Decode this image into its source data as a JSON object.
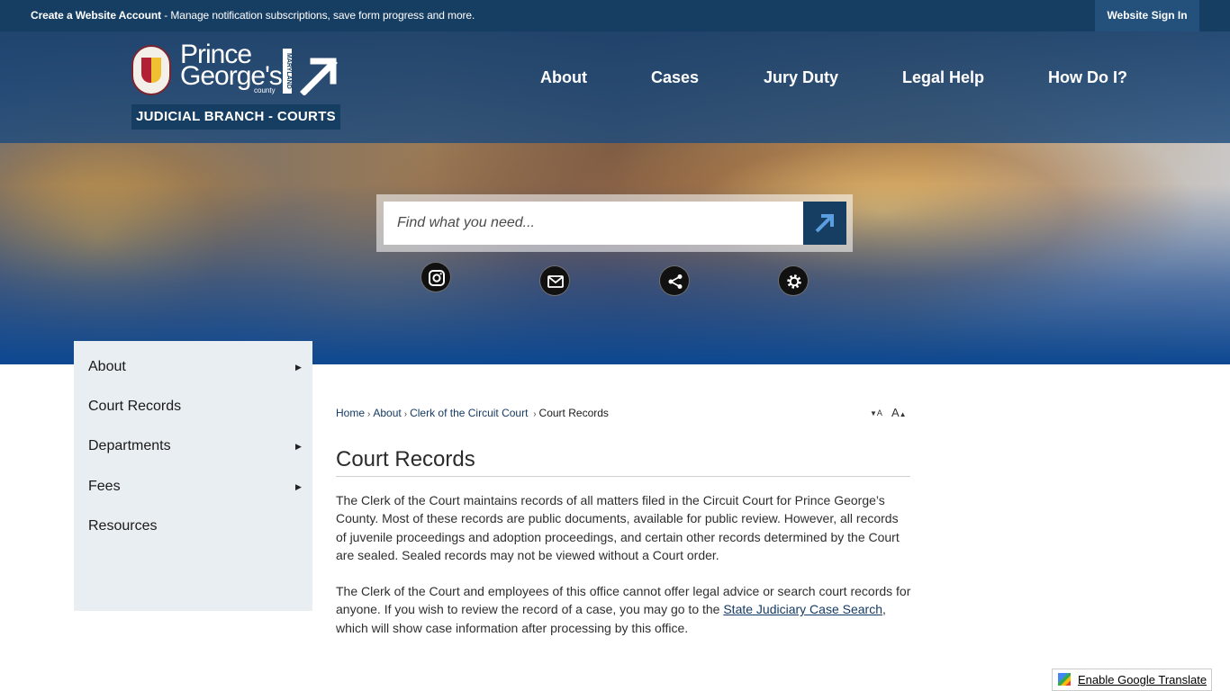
{
  "topbar": {
    "create_account": "Create a Website Account",
    "promo_text": " - Manage notification subscriptions, save form progress and more.",
    "sign_in": "Website Sign In"
  },
  "logo": {
    "line1": "Prince",
    "line2": "George's",
    "county": "county",
    "state": "MARYLAND",
    "subtitle": "JUDICIAL BRANCH - COURTS"
  },
  "nav": {
    "items": [
      "About",
      "Cases",
      "Jury Duty",
      "Legal Help",
      "How Do I?"
    ]
  },
  "search": {
    "placeholder": "Find what you need..."
  },
  "social": {
    "icons": [
      "instagram-icon",
      "email-icon",
      "share-icon",
      "settings-icon"
    ]
  },
  "sidebar": {
    "items": [
      {
        "label": "About",
        "has_submenu": true
      },
      {
        "label": "Court Records",
        "has_submenu": false
      },
      {
        "label": "Departments",
        "has_submenu": true
      },
      {
        "label": "Fees",
        "has_submenu": true
      },
      {
        "label": "Resources",
        "has_submenu": false
      }
    ]
  },
  "breadcrumb": {
    "items": [
      "Home",
      "About",
      "Clerk of the Circuit Court",
      "Court Records"
    ]
  },
  "font_controls": {
    "decrease": "A",
    "increase": "A"
  },
  "content": {
    "title": "Court Records",
    "paragraph1": "The Clerk of the Court maintains records of all matters filed in the Circuit Court for Prince George’s County. Most of these records are public documents, available for public review. However, all records of juvenile proceedings and adoption proceedings, and certain other records determined by the Court are sealed. Sealed records may not be viewed without a Court order.",
    "paragraph2_before": "The Clerk of the Court and employees of this office cannot offer legal advice or search court records for anyone. If you wish to review the record of a case, you may go to the ",
    "paragraph2_link": "State Judiciary Case Search",
    "paragraph2_after": ", which will show case information after processing by this office."
  },
  "translate": {
    "label": "Enable Google Translate"
  },
  "colors": {
    "primary": "#163e63",
    "hero_blue": "#0d4891",
    "sidebar_bg": "#e9eef3"
  }
}
